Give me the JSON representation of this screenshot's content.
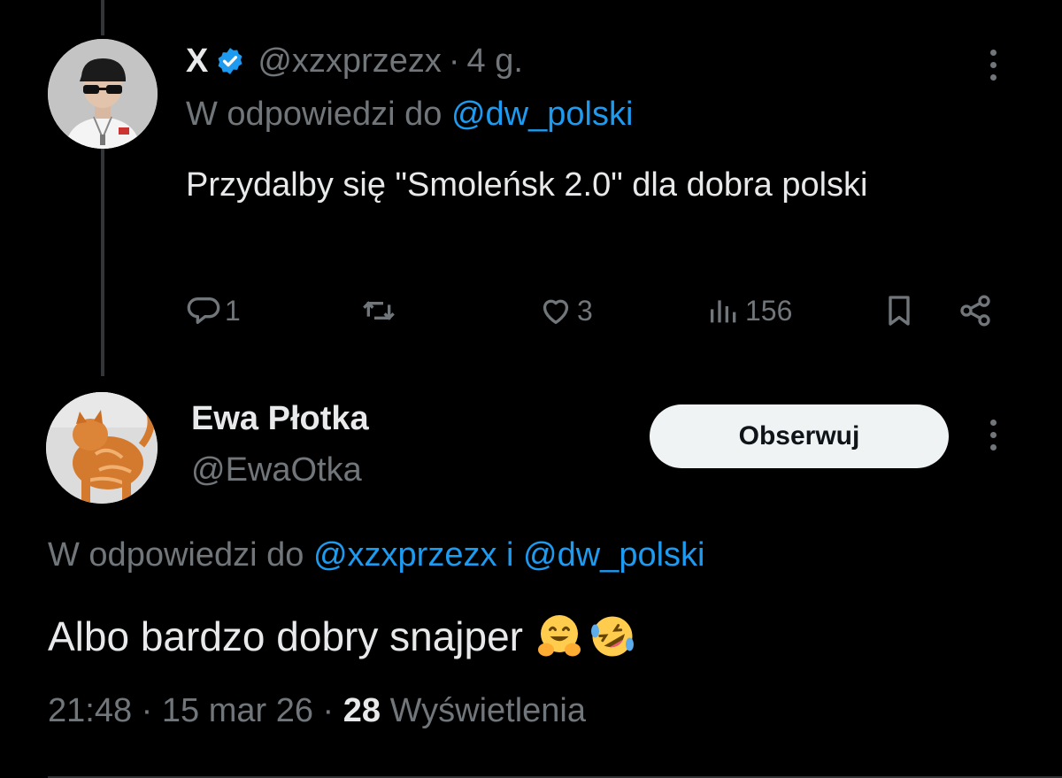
{
  "tweet1": {
    "display_name": "X",
    "handle": "@xzxprzezx",
    "separator": "·",
    "time": "4 g.",
    "reply_prefix": "W odpowiedzi do",
    "reply_mention": "@dw_polski",
    "text": "Przydalby się \"Smoleńsk 2.0\" dla dobra polski",
    "actions": {
      "replies": "1",
      "retweets": "",
      "likes": "3",
      "views": "156"
    },
    "icons": [
      "verified-badge-icon",
      "reply-icon",
      "retweet-icon",
      "like-icon",
      "views-icon",
      "bookmark-icon",
      "share-icon",
      "more-icon"
    ]
  },
  "tweet2": {
    "display_name": "Ewa Płotka",
    "handle": "@EwaOtka",
    "follow_label": "Obserwuj",
    "reply_prefix": "W odpowiedzi do",
    "reply_mention1": "@xzxprzezx",
    "reply_and": "i",
    "reply_mention2": "@dw_polski",
    "text": "Albo bardzo dobry snajper",
    "emojis": [
      "hugging-face-emoji",
      "rolling-on-floor-laughing-emoji"
    ],
    "time": "21:48",
    "separator": "·",
    "date": "15 mar 26",
    "views_count": "28",
    "views_label": "Wyświetlenia"
  },
  "colors": {
    "background": "#000000",
    "text": "#e7e9ea",
    "secondary": "#71767b",
    "link": "#1d9bf0",
    "verified": "#1d9bf0",
    "button_bg": "#eff3f4"
  }
}
